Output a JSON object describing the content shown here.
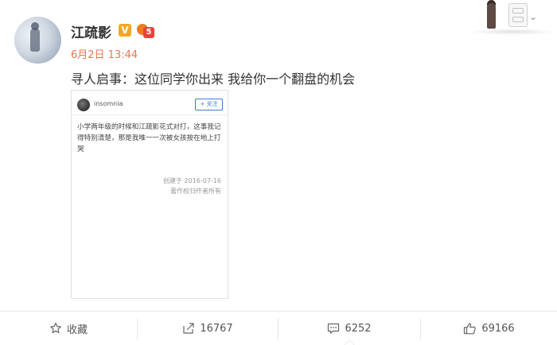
{
  "post": {
    "author": "江疏影",
    "verified_mark": "V",
    "level": "5",
    "date": "6月2日 13:44",
    "text": "寻人启事：这位同学你出来 我给你一个翻盘的机会"
  },
  "embedded_card": {
    "author": "insomnia",
    "follow_label": "+ 关注",
    "text": "小学两年级的时候和江疏影花式对打，这事我记得特别清楚，那是我唯一一次被女孩按在地上打哭",
    "created": "创建于 2016-07-16",
    "copyright": "著作权归作者所有"
  },
  "actions": {
    "favorite": "收藏",
    "repost_count": "16767",
    "comment_count": "6252",
    "like_count": "69166"
  },
  "colors": {
    "date": "#eb7350",
    "follow": "#3a7bd5",
    "verified": "#f5a623"
  }
}
